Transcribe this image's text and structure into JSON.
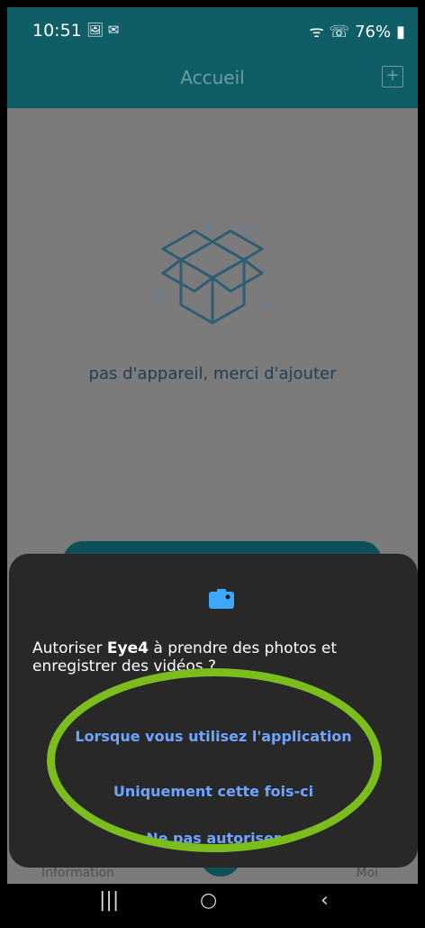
{
  "status_bar": {
    "time": "10:51",
    "left_icons": "🖼 ✉",
    "right_icons": "ᯤ ☏",
    "battery": "76%"
  },
  "app_bar": {
    "title": "Accueil",
    "add_icon": "+"
  },
  "empty_state": {
    "message": "pas d'appareil, merci d'ajouter"
  },
  "bottom_nav": {
    "left_tab": "Information",
    "right_tab": "Moi"
  },
  "dialog": {
    "title_prefix": "Autoriser ",
    "app_name": "Eye4",
    "title_suffix": " à prendre des photos et enregistrer des vidéos ?",
    "options": [
      "Lorsque vous utilisez l'application",
      "Uniquement cette fois-ci",
      "Ne pas autoriser"
    ]
  },
  "system_nav": {
    "recent": "|||",
    "home": "○",
    "back": "‹"
  },
  "colors": {
    "appbar": "#0f5d67",
    "dialog_bg": "#282828",
    "accent_link": "#70a5ff",
    "highlight": "#7cbd1e"
  }
}
